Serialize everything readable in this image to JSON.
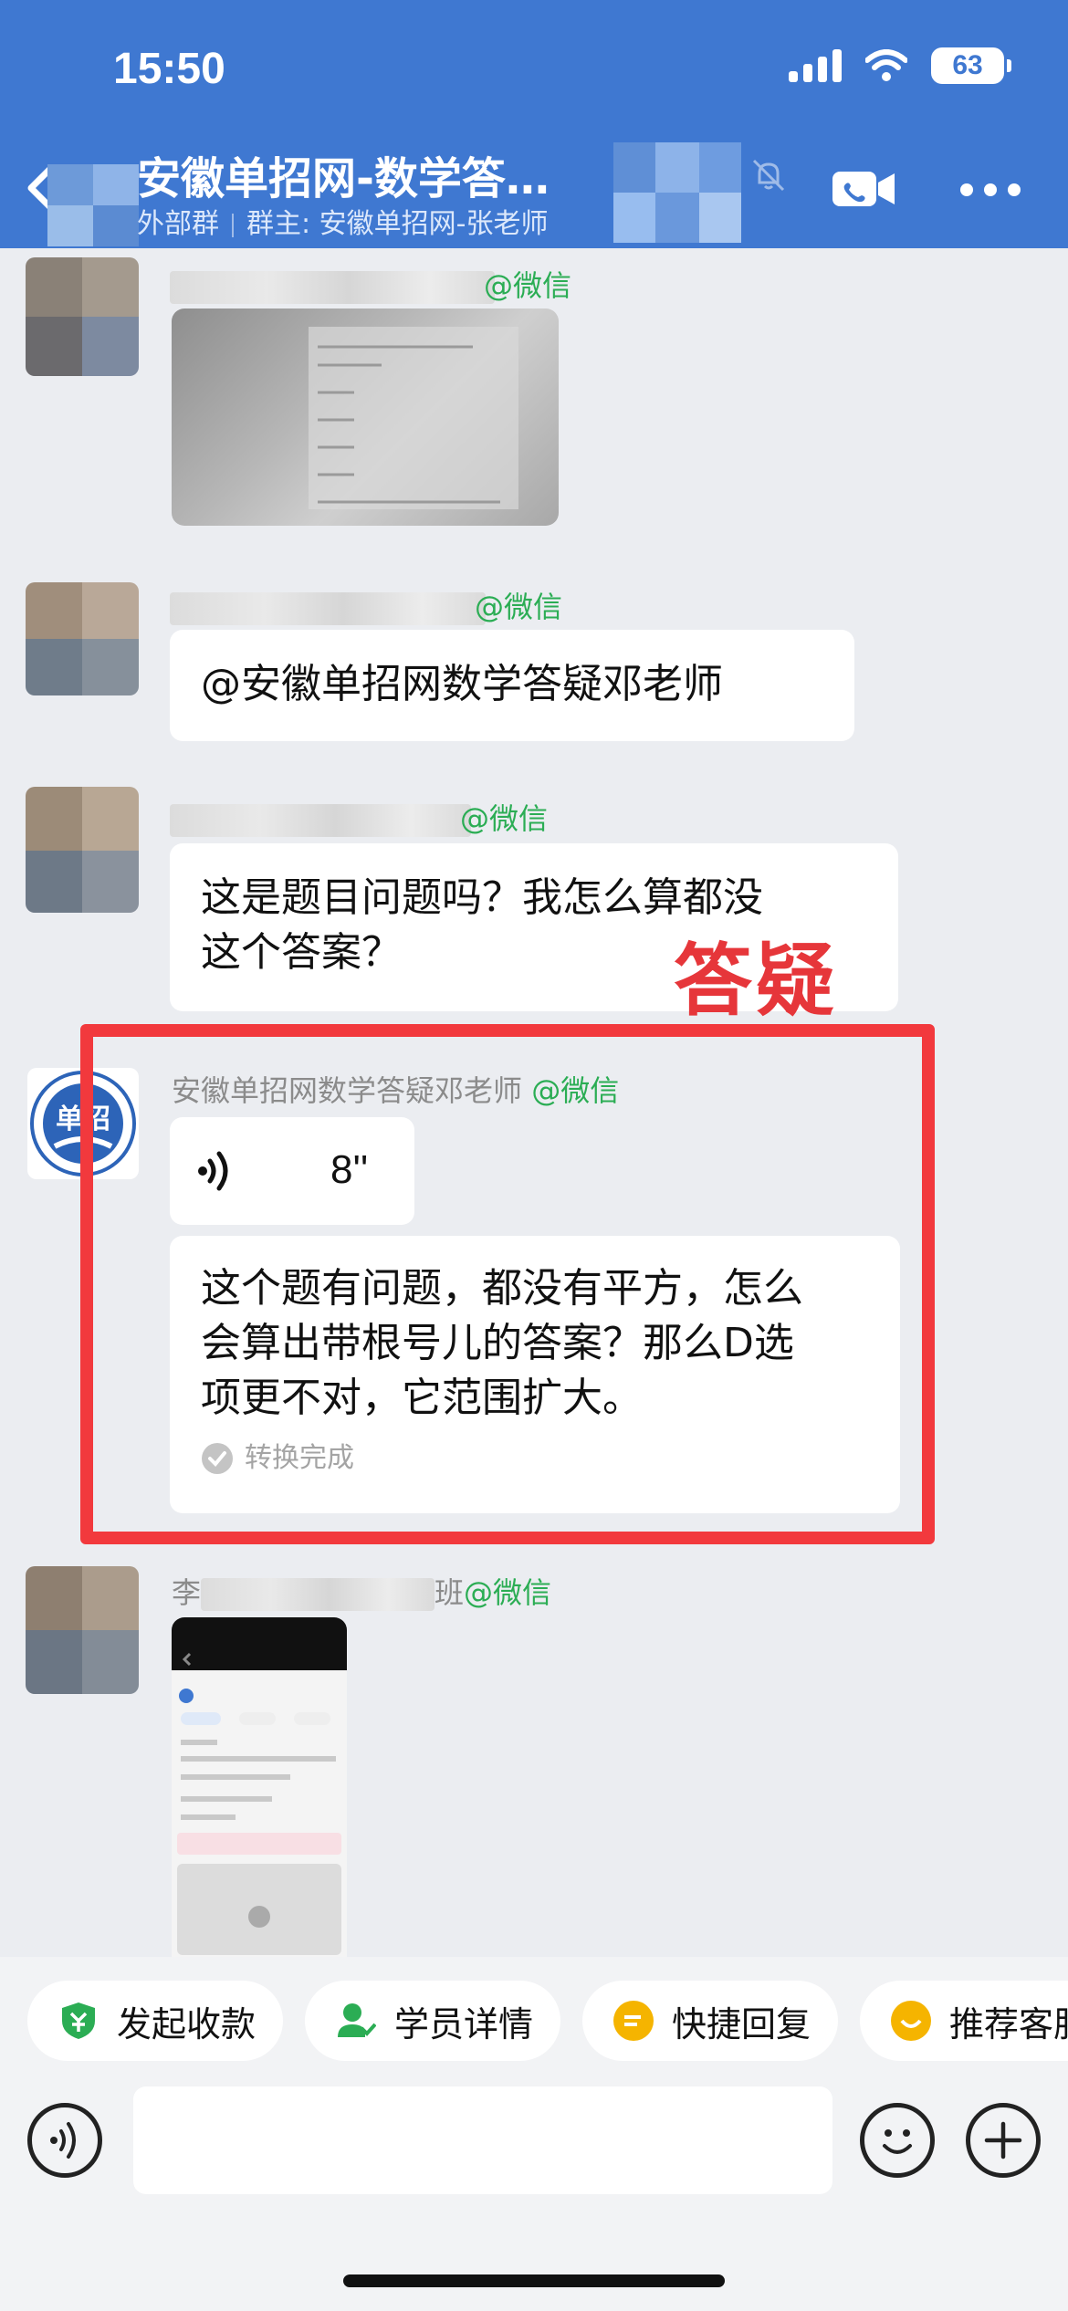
{
  "status_bar": {
    "time": "15:50",
    "battery": "63"
  },
  "header": {
    "title": "安徽单招网-数学答…",
    "subtitle_type": "外部群",
    "subtitle_owner": "群主: 安徽单招网-张老师",
    "subtitle_tail": "…"
  },
  "messages": [
    {
      "sender_suffix": "@微信",
      "type": "image"
    },
    {
      "sender_suffix": "@微信",
      "text": "@安徽单招网数学答疑邓老师"
    },
    {
      "sender_suffix": "@微信",
      "text_line1": "这是题目问题吗？我怎么算都没",
      "text_line2": "这个答案？"
    },
    {
      "sender": "安徽单招网数学答疑邓老师",
      "sender_suffix": "@微信",
      "avatar_text": "单招",
      "voice_duration": "8''",
      "transcript_line1": "这个题有问题，都没有平方，怎么",
      "transcript_line2": "会算出带根号儿的答案？那么D选",
      "transcript_line3": "项更不对，它范围扩大。",
      "transcript_status": "转换完成"
    },
    {
      "sender_prefix": "李",
      "sender_mid": "班",
      "sender_suffix": "@微信",
      "type": "image"
    }
  ],
  "annotation": {
    "overlay_text": "答疑",
    "color": "#f2393d"
  },
  "quick_actions": [
    {
      "label": "发起收款",
      "icon": "shield-yen-icon",
      "color": "#2bad54"
    },
    {
      "label": "学员详情",
      "icon": "user-check-icon",
      "color": "#2bad54"
    },
    {
      "label": "快捷回复",
      "icon": "quick-reply-icon",
      "color": "#f5b400"
    },
    {
      "label": "推荐客服",
      "icon": "recommend-icon",
      "color": "#f5b400"
    }
  ],
  "input": {
    "placeholder": ""
  },
  "colors": {
    "header_bg": "#3f78d1",
    "chat_bg": "#ebedf1",
    "wechat_green": "#2bad54"
  }
}
